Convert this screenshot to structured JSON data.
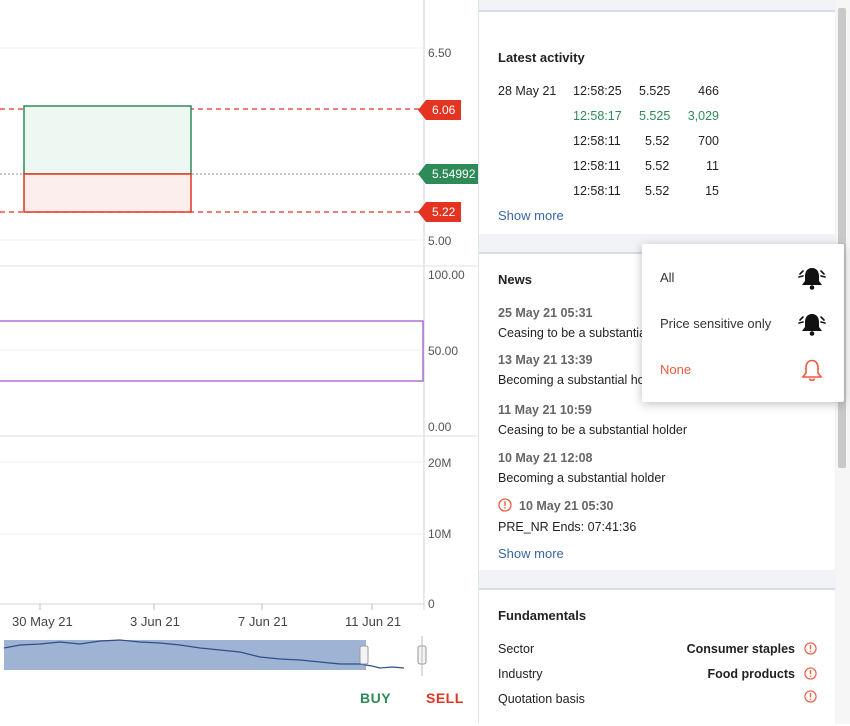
{
  "chart": {
    "price_axis": [
      "6.50",
      "5.00"
    ],
    "price_tags": {
      "upper": "6.06",
      "current": "5.54992",
      "lower": "5.22"
    },
    "oscillator_axis": [
      "100.00",
      "50.00",
      "0.00"
    ],
    "volume_axis": [
      "20M",
      "10M",
      "0"
    ],
    "dates": [
      "30 May 21",
      "3 Jun 21",
      "7 Jun 21",
      "11 Jun 21"
    ],
    "buy_label": "BUY",
    "sell_label": "SELL",
    "colors": {
      "up": "#2e8b57",
      "down": "#e53322",
      "oscillator": "#a35bd0",
      "navigator": "#7f99c6"
    }
  },
  "latest_activity": {
    "title": "Latest activity",
    "date": "28 May 21",
    "rows": [
      {
        "time": "12:58:25",
        "price": "5.525",
        "volume": "466",
        "highlight": false
      },
      {
        "time": "12:58:17",
        "price": "5.525",
        "volume": "3,029",
        "highlight": true
      },
      {
        "time": "12:58:11",
        "price": "5.52",
        "volume": "700",
        "highlight": false
      },
      {
        "time": "12:58:11",
        "price": "5.52",
        "volume": "11",
        "highlight": false
      },
      {
        "time": "12:58:11",
        "price": "5.52",
        "volume": "15",
        "highlight": false
      }
    ],
    "show_more": "Show more"
  },
  "news": {
    "title": "News",
    "items": [
      {
        "meta": "25 May 21 05:31",
        "title": "Ceasing to be a substantial holder"
      },
      {
        "meta": "13 May 21 13:39",
        "title": "Becoming a substantial holder"
      },
      {
        "meta": "11 May 21 10:59",
        "title": "Ceasing to be a substantial holder"
      },
      {
        "meta": "10 May 21 12:08",
        "title": "Becoming a substantial holder"
      },
      {
        "meta": "10 May 21 05:30",
        "title": "PRE_NR Ends: 07:41:36",
        "alert": true
      }
    ],
    "show_more": "Show more"
  },
  "alert_menu": {
    "options": [
      {
        "label": "All",
        "icon": "bell-ringing-icon"
      },
      {
        "label": "Price sensitive only",
        "icon": "bell-ringing-icon"
      },
      {
        "label": "None",
        "icon": "bell-outline-icon",
        "selected": true
      }
    ],
    "colors": {
      "selected": "#ef5a3c"
    }
  },
  "fundamentals": {
    "title": "Fundamentals",
    "rows": [
      {
        "label": "Sector",
        "value": "Consumer staples"
      },
      {
        "label": "Industry",
        "value": "Food products"
      },
      {
        "label": "Quotation basis",
        "value": ""
      }
    ]
  }
}
